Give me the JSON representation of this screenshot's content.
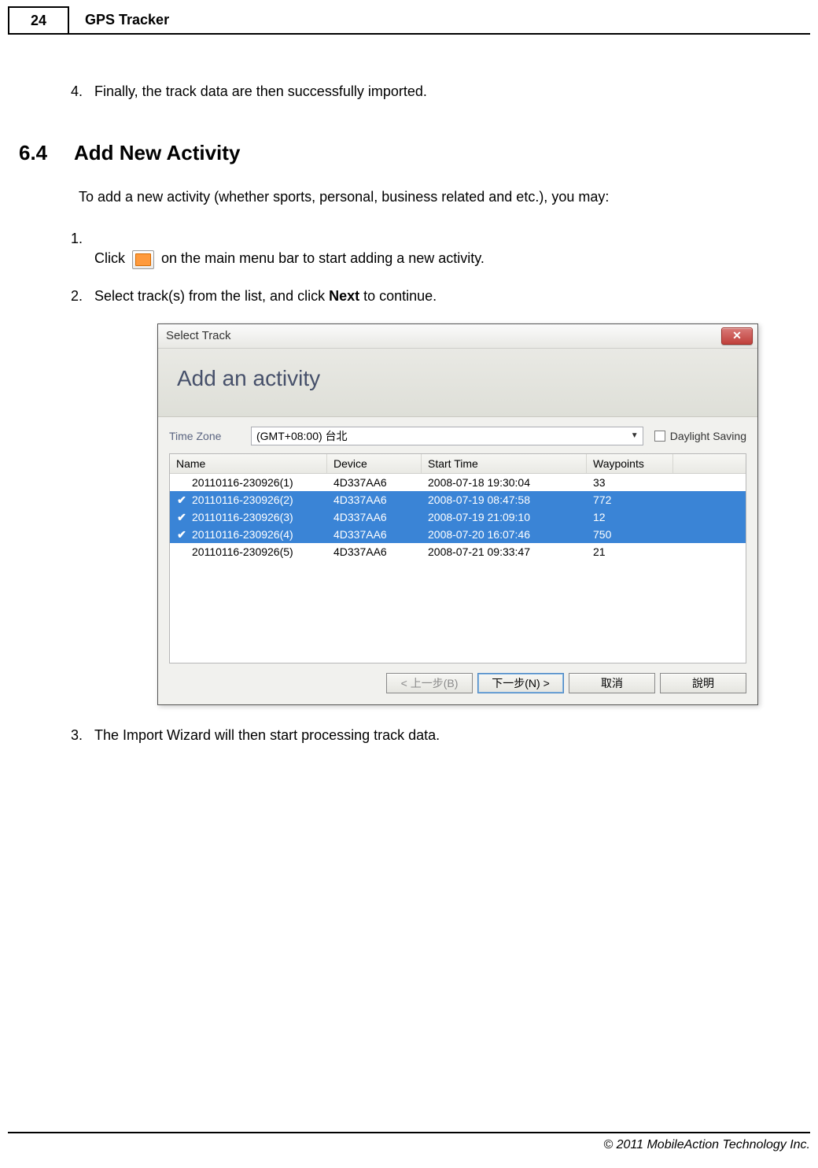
{
  "page": {
    "number": "24",
    "title": "GPS Tracker"
  },
  "preStep": {
    "num": "4.",
    "text": "Finally, the track data are then successfully imported."
  },
  "section": {
    "num": "6.4",
    "title": "Add New Activity"
  },
  "intro": "To add a new activity (whether sports, personal, business related and etc.), you may:",
  "steps": {
    "s1": {
      "num": "1.",
      "pre": "Click",
      "post": " on the main menu bar to start adding a new activity."
    },
    "s2": {
      "num": "2.",
      "pre": "Select track(s) from the list, and click ",
      "bold": "Next",
      "post": " to continue."
    },
    "s3": {
      "num": "3.",
      "text": "The Import Wizard will then start processing track data."
    }
  },
  "dialog": {
    "title": "Select Track",
    "heading": "Add an activity",
    "tzLabel": "Time Zone",
    "tzValue": "(GMT+08:00) 台北",
    "daylight": "Daylight Saving",
    "cols": {
      "name": "Name",
      "device": "Device",
      "start": "Start Time",
      "wp": "Waypoints"
    },
    "rows": [
      {
        "selected": false,
        "name": "20110116-230926(1)",
        "device": "4D337AA6",
        "start": "2008-07-18 19:30:04",
        "wp": "33"
      },
      {
        "selected": true,
        "name": "20110116-230926(2)",
        "device": "4D337AA6",
        "start": "2008-07-19 08:47:58",
        "wp": "772"
      },
      {
        "selected": true,
        "name": "20110116-230926(3)",
        "device": "4D337AA6",
        "start": "2008-07-19 21:09:10",
        "wp": "12"
      },
      {
        "selected": true,
        "name": "20110116-230926(4)",
        "device": "4D337AA6",
        "start": "2008-07-20 16:07:46",
        "wp": "750"
      },
      {
        "selected": false,
        "name": "20110116-230926(5)",
        "device": "4D337AA6",
        "start": "2008-07-21 09:33:47",
        "wp": "21"
      }
    ],
    "buttons": {
      "back": "< 上一步(B)",
      "next": "下一步(N) >",
      "cancel": "取消",
      "help": "說明"
    }
  },
  "footer": "© 2011 MobileAction Technology Inc."
}
